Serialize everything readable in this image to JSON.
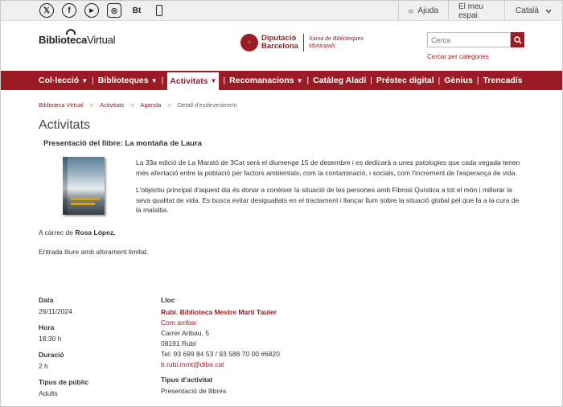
{
  "topbar": {
    "social": [
      {
        "icon": "x-twitter-icon",
        "glyph": "𝕏"
      },
      {
        "icon": "facebook-icon",
        "glyph": "f"
      },
      {
        "icon": "youtube-icon",
        "glyph": "▶"
      },
      {
        "icon": "instagram-icon",
        "glyph": "◎"
      },
      {
        "icon": "bluesky-bt-icon",
        "glyph": "Bt"
      },
      {
        "icon": "phone-icon",
        "glyph": ""
      }
    ],
    "help": "Ajuda",
    "my_space": "El meu espai",
    "language": "Català"
  },
  "header": {
    "logo_bold": "Biblioteca",
    "logo_light": "Virtual",
    "dipu_line1": "Diputació",
    "dipu_line2": "Barcelona",
    "xarxa_line1": "Xarxa de Biblioteques",
    "xarxa_line2": "Municipals",
    "search_placeholder": "Cerca",
    "search_by_category": "Cercar per categories"
  },
  "nav": {
    "items": [
      {
        "label": "Col·lecció",
        "dropdown": true
      },
      {
        "label": "Biblioteques",
        "dropdown": true
      },
      {
        "label": "Activitats",
        "dropdown": true,
        "active": true
      },
      {
        "label": "Recomanacions",
        "dropdown": true
      },
      {
        "label": "Catàleg Aladí",
        "dropdown": false
      },
      {
        "label": "Préstec digital",
        "dropdown": false
      },
      {
        "label": "Gènius",
        "dropdown": false
      },
      {
        "label": "Trencadís",
        "dropdown": false
      }
    ]
  },
  "breadcrumb": {
    "items": [
      "Biblioteca Virtual",
      "Activitats",
      "Agenda"
    ],
    "current": "Detall d'esdeveniment"
  },
  "page": {
    "title": "Activitats",
    "event_title": "Presentació del llibre: La montaña de Laura",
    "paragraph1": "La 33a edició de La Marató de 3Cat serà el diumenge 15 de desembre i es dedicarà a unes patologies que cada vegada tenen més afectació entre la població per factors ambientals, com la contaminació, i socials, com l'increment de l'esperança de vida.",
    "paragraph2": "L'objectiu principal d'aquest dia és donar a conèixer la situació de les persones amb Fibrosi Quística a tot el món i millorar la seva qualitat de vida. Es busca evitar desigualtats en el tractament i llançar llum sobre la situació global pel que fa a la cura de la malaltia.",
    "organizer_prefix": "A càrrec de",
    "organizer_name": "Rosa López.",
    "entry": "Entrada lliure amb aforament limitat."
  },
  "details": {
    "date_label": "Data",
    "date": "26/11/2024",
    "time_label": "Hora",
    "time": "18:30 h",
    "duration_label": "Duració",
    "duration": "2 h",
    "audience_label": "Tipus de públic",
    "audience": "Adults",
    "place_label": "Lloc",
    "place_name": "Rubí. Biblioteca Mestre Martí Tauler",
    "directions": "Com arribar",
    "address": "Carrer Aribau, 5",
    "postcode_city": "08191 Rubí",
    "phone": "Tel: 93 699 84 53 / 93 588 70 00 #6820",
    "email": "b.rubi.mmt@diba.cat",
    "activity_type_label": "Tipus d'activitat",
    "activity_type": "Presentació de llibres"
  },
  "colors": {
    "brand": "#9b1c24",
    "topbar_bg": "#efefef"
  }
}
